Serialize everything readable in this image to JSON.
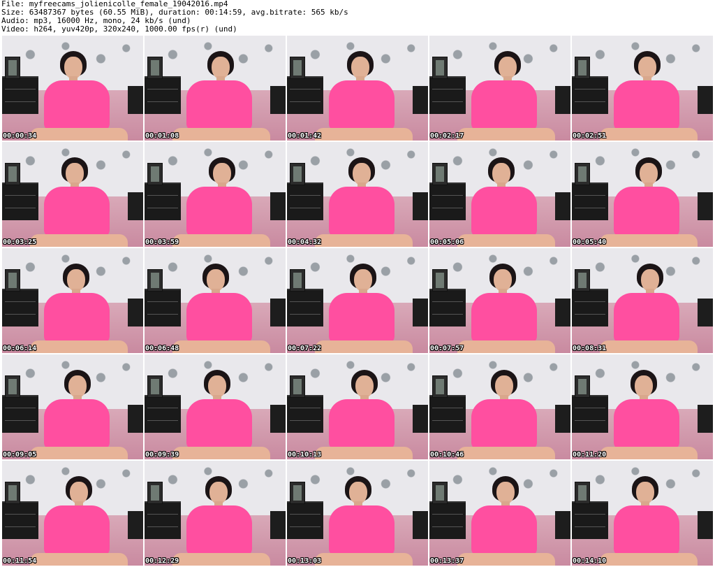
{
  "header": {
    "file": "File: myfreecams_jolienicolle_female_19042016.mp4",
    "size": "Size: 63487367 bytes (60.55 MiB), duration: 00:14:59, avg.bitrate: 565 kb/s",
    "audio": "Audio: mp3, 16000 Hz, mono, 24 kb/s (und)",
    "video": "Video: h264, yuv420p, 320x240, 1000.00 fps(r) (und)"
  },
  "thumbnails": [
    {
      "time": "00:00:34"
    },
    {
      "time": "00:01:08"
    },
    {
      "time": "00:01:42"
    },
    {
      "time": "00:02:17"
    },
    {
      "time": "00:02:51"
    },
    {
      "time": "00:03:25"
    },
    {
      "time": "00:03:59"
    },
    {
      "time": "00:04:32"
    },
    {
      "time": "00:05:06"
    },
    {
      "time": "00:05:40"
    },
    {
      "time": "00:06:14"
    },
    {
      "time": "00:06:48"
    },
    {
      "time": "00:07:22"
    },
    {
      "time": "00:07:57"
    },
    {
      "time": "00:08:31"
    },
    {
      "time": "00:09:05"
    },
    {
      "time": "00:09:39"
    },
    {
      "time": "00:10:13"
    },
    {
      "time": "00:10:46"
    },
    {
      "time": "00:11:20"
    },
    {
      "time": "00:11:54"
    },
    {
      "time": "00:12:29"
    },
    {
      "time": "00:13:03"
    },
    {
      "time": "00:13:37"
    },
    {
      "time": "00:14:10"
    }
  ],
  "colors": {
    "background": "#ffffff",
    "timestamp_text": "#ffffff",
    "timestamp_outline": "#000000",
    "shirt": "#ff4fa0"
  }
}
